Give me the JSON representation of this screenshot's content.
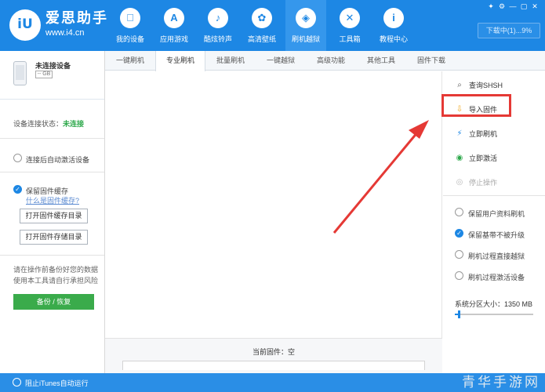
{
  "brand": {
    "logo_text": "iU",
    "name": "爱思助手",
    "url": "www.i4.cn"
  },
  "nav": [
    {
      "label": "我的设备",
      "icon": "apple-icon",
      "glyph": ""
    },
    {
      "label": "应用游戏",
      "icon": "app-store-icon",
      "glyph": "A"
    },
    {
      "label": "酷炫铃声",
      "icon": "bell-icon",
      "glyph": "♪"
    },
    {
      "label": "高清壁纸",
      "icon": "flower-icon",
      "glyph": "✿"
    },
    {
      "label": "刷机越狱",
      "icon": "dropbox-icon",
      "glyph": "◈"
    },
    {
      "label": "工具箱",
      "icon": "tools-icon",
      "glyph": "✕"
    },
    {
      "label": "教程中心",
      "icon": "info-icon",
      "glyph": "i"
    }
  ],
  "nav_active_index": 4,
  "window": {
    "download_label": "下载中(1)...9%"
  },
  "device": {
    "name": "未连接设备",
    "storage": "-- GB"
  },
  "left_panel": {
    "status_label": "设备连接状态：",
    "status_value": "未连接",
    "auto_activate_label": "连接后自动激活设备",
    "keep_cache_label": "保留固件缓存",
    "cache_link": "什么是固件缓存?",
    "open_cache_dir": "打开固件缓存目录",
    "open_store_dir": "打开固件存储目录",
    "warning_text": "请在操作前备份好您的数据使用本工具请自行承担风险",
    "backup_button": "备份 / 恢复"
  },
  "tabs": [
    "一键刷机",
    "专业刷机",
    "批量刷机",
    "一键越狱",
    "高级功能",
    "其他工具",
    "固件下载"
  ],
  "active_tab": 1,
  "center": {
    "firmware_label": "当前固件：空"
  },
  "right_panel": {
    "actions": [
      {
        "label": "查询SHSH",
        "icon": "search-icon",
        "glyph": "⌕",
        "color": "#555555"
      },
      {
        "label": "导入固件",
        "icon": "import-folder-icon",
        "glyph": "⇩",
        "color": "#f0a820"
      },
      {
        "label": "立即刷机",
        "icon": "flash-icon",
        "glyph": "⚡",
        "color": "#1d87e4"
      },
      {
        "label": "立即激活",
        "icon": "globe-icon",
        "glyph": "◉",
        "color": "#2ca84a"
      },
      {
        "label": "停止操作",
        "icon": "stop-icon",
        "glyph": "◎",
        "color": "#bbbbbb"
      }
    ],
    "options": [
      {
        "label": "保留用户资料刷机",
        "checked": false
      },
      {
        "label": "保留基带不被升级",
        "checked": true
      },
      {
        "label": "刷机过程直接越狱",
        "checked": false
      },
      {
        "label": "刷机过程激活设备",
        "checked": false
      }
    ],
    "partition_label": "系统分区大小：1350 MB",
    "partition_fraction": 0.05
  },
  "bottom": {
    "itunes_label": "阻止iTunes自动运行",
    "watermark": "青华手游网"
  },
  "colors": {
    "primary": "#1d87e4",
    "success": "#3aab4b",
    "highlight": "#e53935"
  }
}
